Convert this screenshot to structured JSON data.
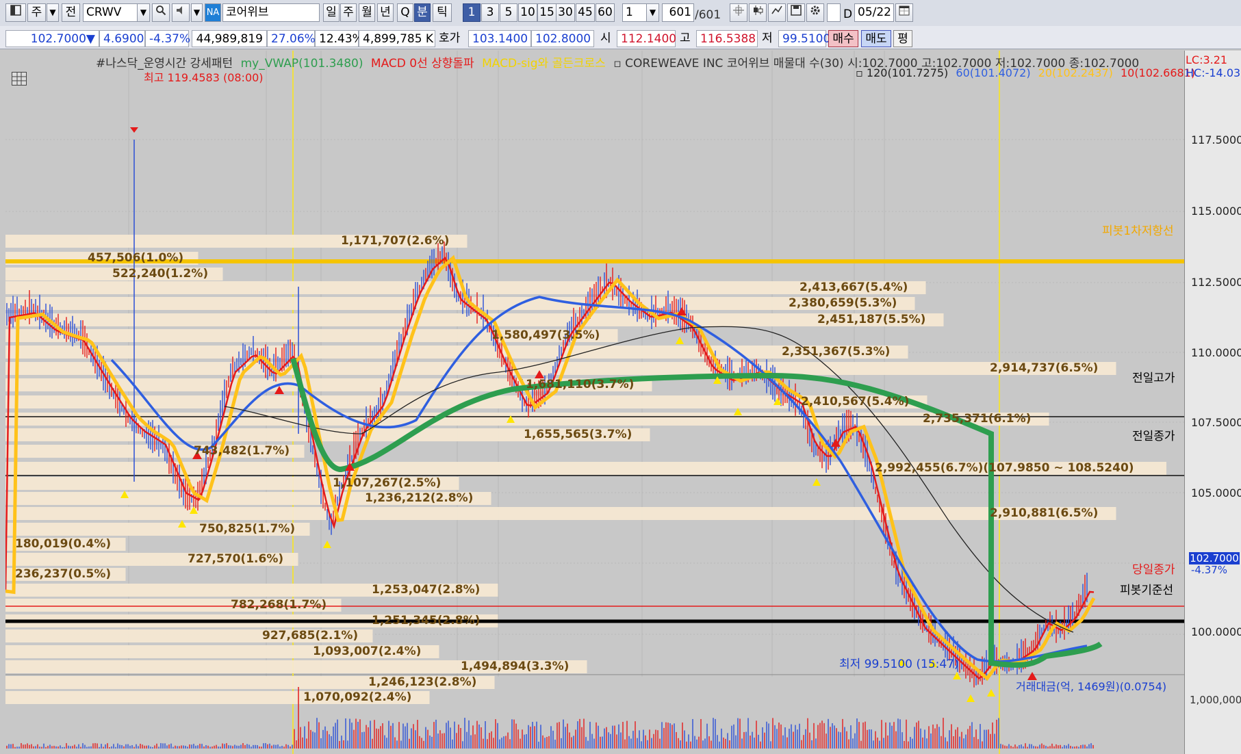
{
  "toolbar": {
    "btn_a": "주",
    "btn_b": "전",
    "symbol_code": "CRWV",
    "market_badge": "NA",
    "stock_name": "코어위브",
    "periods": [
      "일",
      "주",
      "월",
      "년",
      "Q",
      "분",
      "틱"
    ],
    "active_period": "분",
    "intervals": [
      "1",
      "3",
      "5",
      "10",
      "15",
      "30",
      "45",
      "60"
    ],
    "active_interval": "1",
    "interval_input": "1",
    "count_value": "601",
    "count_total": "/601",
    "d_label": "D",
    "date_value": "05/22"
  },
  "infobar": {
    "price": "102.7000",
    "change_arrow": "▼",
    "change": "4.6900",
    "change_pct": "-4.37%",
    "volume": "44,989,819",
    "rate1": "27.06%",
    "rate2": "12.43%",
    "amount": "4,899,785 K",
    "quote_label": "호가",
    "ask": "103.1400",
    "bid": "102.8000",
    "open_label": "시",
    "open": "112.1400",
    "high_label": "고",
    "high": "116.5388",
    "low_label": "저",
    "low": "99.5100",
    "buy_label": "매수",
    "sell_label": "매도",
    "flat_label": "평"
  },
  "legend": {
    "line1_a": "#나스닥_운영시간 강세패턴",
    "line1_b": "my_VWAP(101.3480)",
    "line1_c": "MACD 0선 상향돌파",
    "line1_d": "MACD-sig와 골든크로스",
    "line1_e": "▫ COREWEAVE INC  코어위브 매물대 수(30)  시:102.7000 고:102.7000 저:102.7000 종:102.7000",
    "line2_a": "▫ 120(101.7275)",
    "line2_b": "60(101.4072)",
    "line2_c": "20(102.2437)",
    "line2_d": "10(102.6681)",
    "lc": "LC:3.21",
    "hc": "HC:-14.03",
    "colors": {
      "vwap": "#2e9e4f",
      "macd": "#e41a1a",
      "sig": "#f2d300",
      "ma120": "#222222",
      "ma60": "#2f5fe0",
      "ma20": "#ffc21a",
      "ma10": "#e41a1a"
    }
  },
  "annotations": {
    "high_marker": "최고 119.4583 (08:00)",
    "low_marker": "최저 99.5100 (15:47)",
    "prev_high": "전일고가",
    "prev_close": "전일종가",
    "today_close": "당일종가",
    "pivot": "피봇기준선",
    "pivot_resist": "피봇1차저항선",
    "volume_title": "거래대금(억, 1469원)(0.0754)",
    "price_tag": "102.7000",
    "price_tag_pct": "-4.37%"
  },
  "volume_profile": [
    "1,171,707(2.6%)",
    "457,506(1.0%)",
    "522,240(1.2%)",
    "2,413,667(5.4%)",
    "2,380,659(5.3%)",
    "2,451,187(5.5%)",
    "1,580,497(3.5%)",
    "2,351,367(5.3%)",
    "2,914,737(6.5%)",
    "1,681,110(3.7%)",
    "2,410,567(5.4%)",
    "2,735,371(6.1%)",
    "1,655,565(3.7%)",
    "743,482(1.7%)",
    "2,992,455(6.7%)(107.9850 ~ 108.5240)",
    "1,107,267(2.5%)",
    "1,236,212(2.8%)",
    "2,910,881(6.5%)",
    "750,825(1.7%)",
    "180,019(0.4%)",
    "727,570(1.6%)",
    "236,237(0.5%)",
    "1,253,047(2.8%)",
    "782,268(1.7%)",
    "1,251,345(2.8%)",
    "927,685(2.1%)",
    "1,093,007(2.4%)",
    "1,494,894(3.3%)",
    "1,246,123(2.8%)",
    "1,070,092(2.4%)"
  ],
  "price_axis": [
    "117.5000",
    "115.0000",
    "112.5000",
    "110.0000",
    "107.5000",
    "105.0000",
    "100.0000"
  ],
  "volume_axis": "1,000,000"
}
